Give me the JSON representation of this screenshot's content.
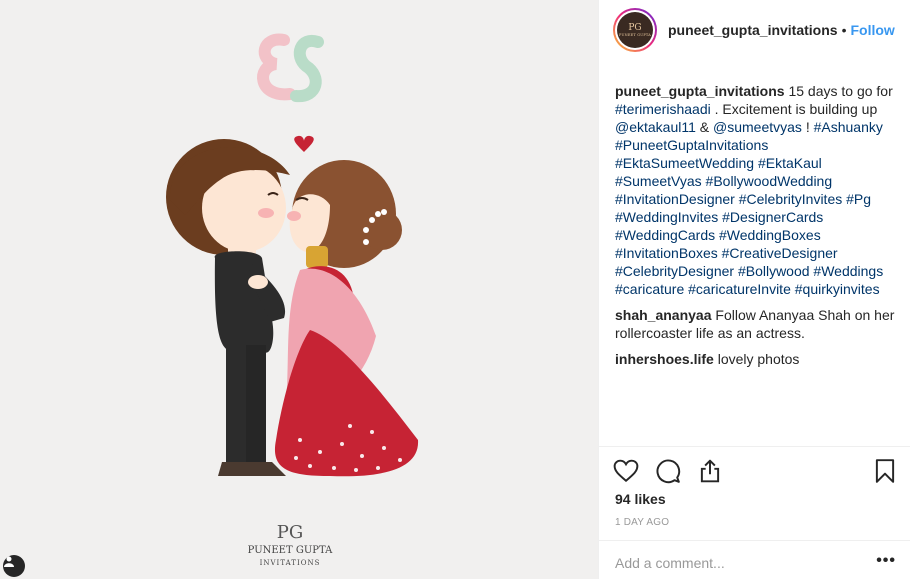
{
  "post": {
    "brand_line1": "PUNEET GUPTA",
    "brand_line2": "INVITATIONS",
    "brand_monogram": "PG"
  },
  "header": {
    "username": "puneet_gupta_invitations",
    "separator": "•",
    "follow_label": "Follow",
    "avatar_line1": "PG",
    "avatar_line2": "PUNEET GUPTA"
  },
  "caption": {
    "author": "puneet_gupta_invitations",
    "text_1": " 15 days to go for ",
    "tag_1": "#terimerishaadi",
    "text_2": " . Excitement is building up ",
    "mention_1": "@ektakaul11",
    "text_3": " & ",
    "mention_2": "@sumeetvyas",
    "text_4": " ! ",
    "hashtags": "#Ashuanky #PuneetGuptaInvitations #EktaSumeetWedding #EktaKaul #SumeetVyas #BollywoodWedding #InvitationDesigner #CelebrityInvites #Pg #WeddingInvites #DesignerCards #WeddingCards #WeddingBoxes #InvitationBoxes #CreativeDesigner #CelebrityDesigner #Bollywood #Weddings #caricature #caricatureInvite #quirkyinvites"
  },
  "comments": [
    {
      "author": "shah_ananyaa",
      "text": " Follow Ananyaa Shah on her rollercoaster life as an actress."
    },
    {
      "author": "inhershoes.life",
      "text": " lovely photos"
    }
  ],
  "stats": {
    "likes": "94 likes",
    "time": "1 DAY AGO"
  },
  "composer": {
    "placeholder": "Add a comment...",
    "more": "•••"
  },
  "icons": {
    "like": "heart-icon",
    "comment": "comment-icon",
    "share": "share-icon",
    "save": "bookmark-icon",
    "tag": "user-tag-icon"
  },
  "colors": {
    "link": "#003569",
    "follow": "#3897f0",
    "muted": "#999999"
  }
}
